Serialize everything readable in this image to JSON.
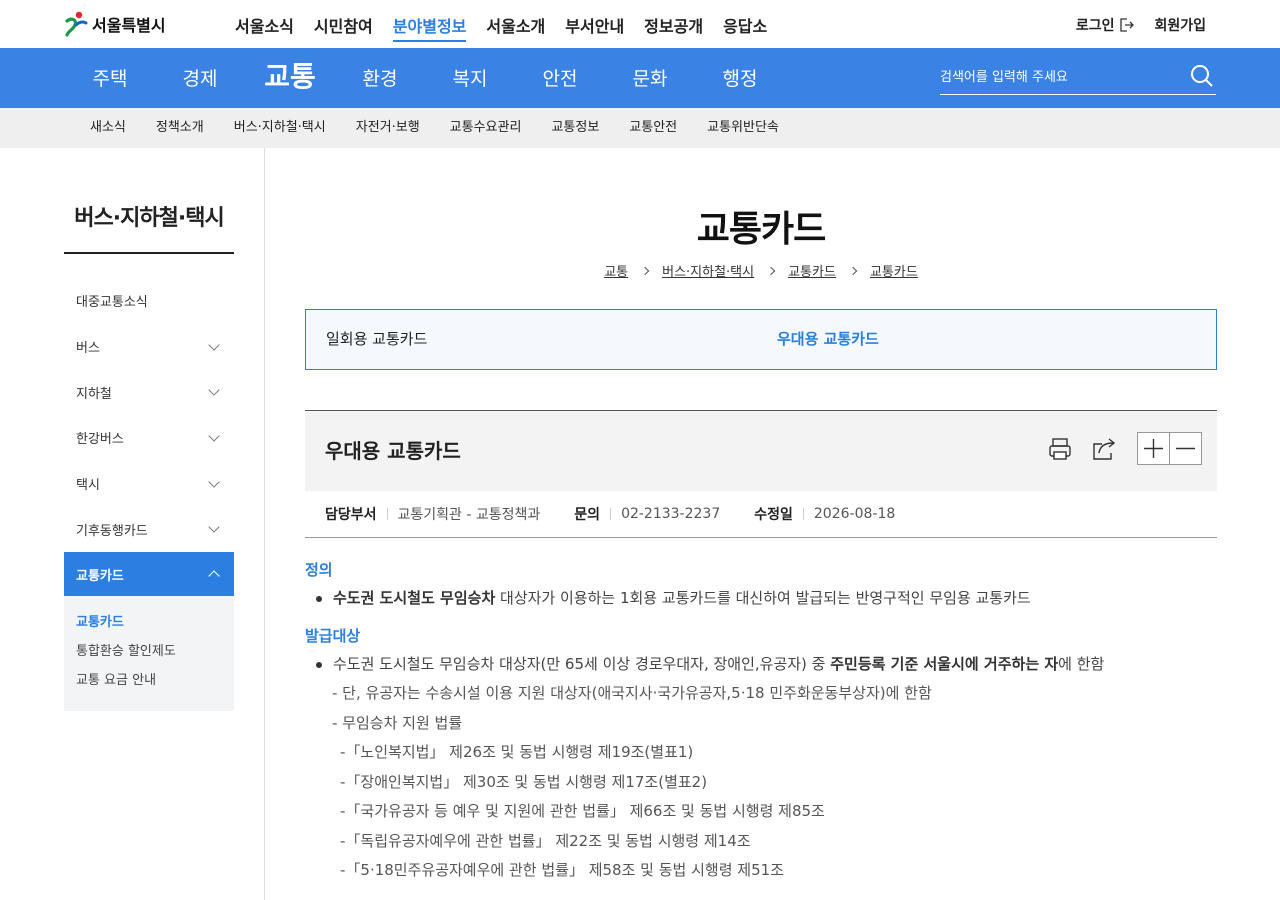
{
  "header": {
    "logo_text": "서울특별시",
    "gnb": [
      "서울소식",
      "시민참여",
      "분야별정보",
      "서울소개",
      "부서안내",
      "정보공개",
      "응답소"
    ],
    "gnb_active_index": 2,
    "login": "로그인",
    "signup": "회원가입"
  },
  "categories": {
    "items": [
      "주택",
      "경제",
      "교통",
      "환경",
      "복지",
      "안전",
      "문화",
      "행정"
    ],
    "active_index": 2,
    "search_placeholder": "검색어를 입력해 주세요"
  },
  "subnav": [
    "새소식",
    "정책소개",
    "버스·지하철·택시",
    "자전거·보행",
    "교통수요관리",
    "교통정보",
    "교통안전",
    "교통위반단속"
  ],
  "sidebar": {
    "title": "버스·지하철·택시",
    "items": [
      {
        "label": "대중교통소식",
        "expandable": false
      },
      {
        "label": "버스",
        "expandable": true
      },
      {
        "label": "지하철",
        "expandable": true
      },
      {
        "label": "한강버스",
        "expandable": true
      },
      {
        "label": "택시",
        "expandable": true
      },
      {
        "label": "기후동행카드",
        "expandable": true
      },
      {
        "label": "교통카드",
        "expandable": true,
        "active": true
      }
    ],
    "sub_items": [
      "교통카드",
      "통합환승 할인제도",
      "교통 요금 안내"
    ],
    "sub_current_index": 0
  },
  "page": {
    "title": "교통카드",
    "breadcrumb": [
      "교통",
      "버스·지하철·택시",
      "교통카드",
      "교통카드"
    ]
  },
  "tabs": {
    "items": [
      "일회용 교통카드",
      "우대용 교통카드"
    ],
    "active_index": 1
  },
  "article": {
    "title": "우대용 교통카드",
    "meta": {
      "dept_label": "담당부서",
      "dept_value": "교통기획관 - 교통정책과",
      "contact_label": "문의",
      "contact_value": "02-2133-2237",
      "modified_label": "수정일",
      "modified_value": "2026-08-18"
    },
    "sections": {
      "definition_title": "정의",
      "definition_bold": "수도권 도시철도 무임승차",
      "definition_text": " 대상자가 이용하는 1회용 교통카드를 대신하여 발급되는 반영구적인 무임용 교통카드",
      "target_title": "발급대상",
      "target_pre": "수도권 도시철도 무임승차 대상자(만 65세 이상 경로우대자, 장애인,유공자) 중 ",
      "target_bold": "주민등록 기준 서울시에 거주하는 자",
      "target_post": "에 한함",
      "sub1": "- 단, 유공자는 수송시설 이용 지원 대상자(애국지사·국가유공자,5·18 민주화운동부상자)에 한함",
      "sub2": "- 무임승차 지원 법률",
      "laws": [
        "-「노인복지법」 제26조 및 동법 시행령 제19조(별표1)",
        "-「장애인복지법」 제30조 및 동법 시행령 제17조(별표2)",
        "-「국가유공자 등 예우 및 지원에 관한 법률」 제66조 및 동법 시행령 제85조",
        "-「독립유공자예우에 관한 법률」 제22조 및 동법 시행령 제14조",
        "-「5·18민주유공자예우에 관한 법률」 제58조 및 동법 시행령 제51조"
      ]
    }
  },
  "colors": {
    "brand_blue": "#3a82e4",
    "accent_blue": "#2b7fe0"
  }
}
